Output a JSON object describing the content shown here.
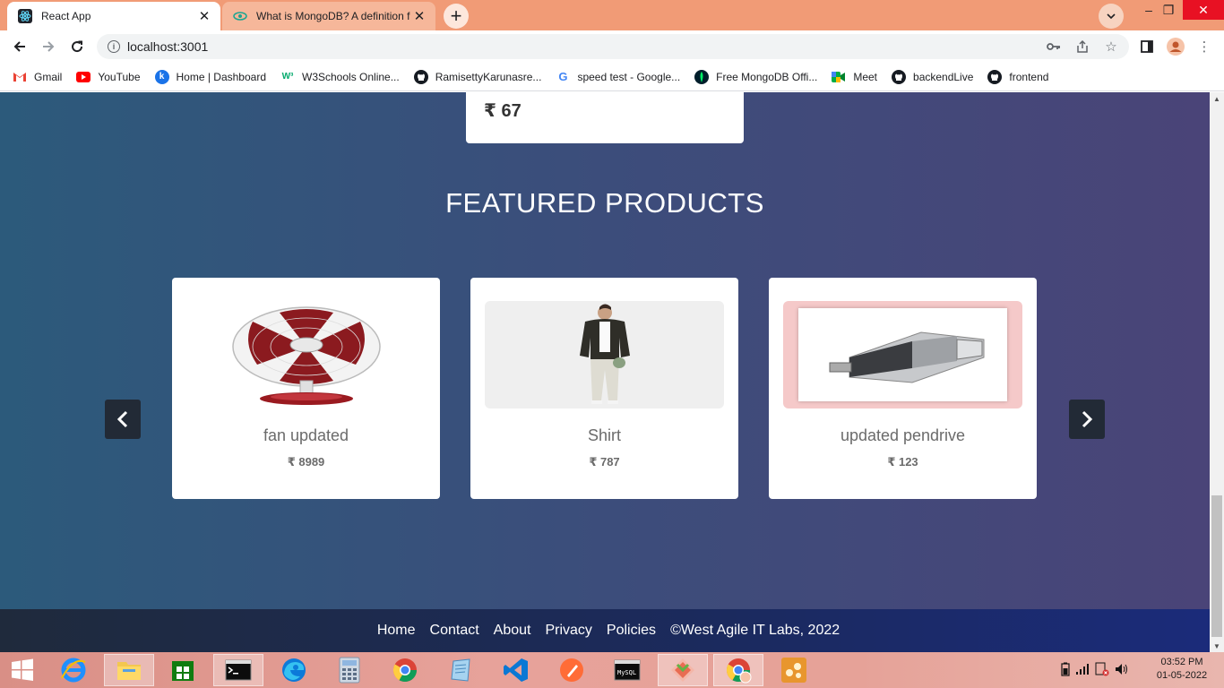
{
  "browser": {
    "tabs": [
      {
        "title": "React App",
        "active": true
      },
      {
        "title": "What is MongoDB? A definition f",
        "active": false
      }
    ],
    "url": "localhost:3001",
    "bookmarks": [
      {
        "label": "Gmail",
        "icon": "gmail-icon"
      },
      {
        "label": "YouTube",
        "icon": "youtube-icon"
      },
      {
        "label": "Home | Dashboard",
        "icon": "k-icon"
      },
      {
        "label": "W3Schools Online...",
        "icon": "w3schools-icon"
      },
      {
        "label": "RamisettyKarunasre...",
        "icon": "github-icon"
      },
      {
        "label": "speed test - Google...",
        "icon": "google-icon"
      },
      {
        "label": "Free MongoDB Offi...",
        "icon": "mongodb-icon"
      },
      {
        "label": "Meet",
        "icon": "meet-icon"
      },
      {
        "label": "backendLive",
        "icon": "github-icon"
      },
      {
        "label": "frontend",
        "icon": "github-icon"
      }
    ]
  },
  "page": {
    "top_card_price": "₹ 67",
    "section_title": "FEATURED PRODUCTS",
    "products": [
      {
        "name": "fan updated",
        "price": "₹ 8989",
        "image": "table-fan-image"
      },
      {
        "name": "Shirt",
        "price": "₹ 787",
        "image": "man-in-jacket-image"
      },
      {
        "name": "updated pendrive",
        "price": "₹ 123",
        "image": "usb-pendrive-image"
      }
    ],
    "footer": {
      "links": [
        "Home",
        "Contact",
        "About",
        "Privacy",
        "Policies"
      ],
      "copyright": "©West Agile IT Labs, 2022"
    }
  },
  "taskbar": {
    "time": "03:52 PM",
    "date": "01-05-2022"
  },
  "colors": {
    "tab_strip": "#f19b76",
    "page_gradient_start": "#2c5a7b",
    "page_gradient_end": "#4a4478",
    "footer": "#1b2a5e",
    "carousel_arrow": "#222a36"
  }
}
